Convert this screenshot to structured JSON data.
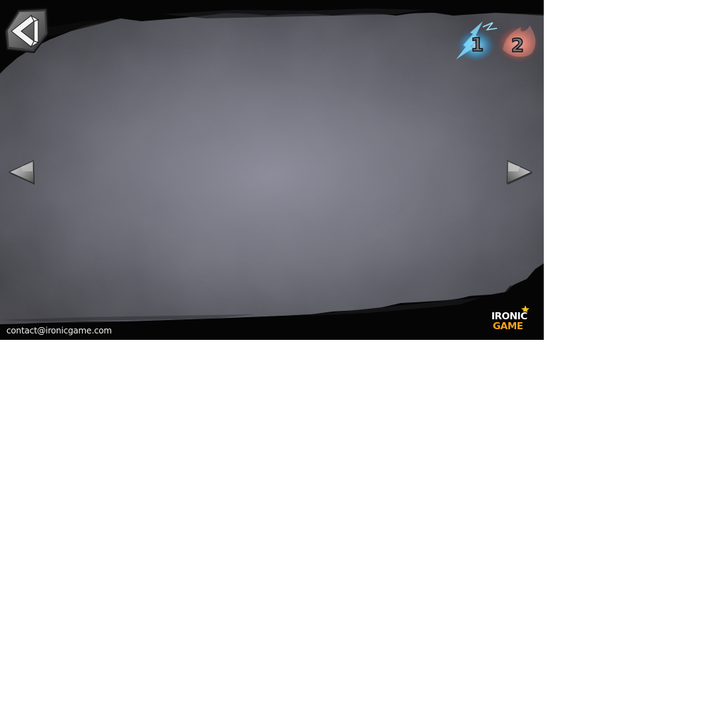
{
  "footer": {
    "contact_email": "contact@ironicgame.com"
  },
  "hud": {
    "player_badges": [
      {
        "label": "1",
        "glow_color": "#3fc0ff"
      },
      {
        "label": "2",
        "glow_color": "#ff7a6a"
      }
    ]
  },
  "logo": {
    "line_1": "IRONIC",
    "line_2": "GAME",
    "star_color": "#f6c21c",
    "accent_color": "#f6a21c"
  },
  "icons": {
    "home": "unity-cube-icon",
    "previous": "arrow-left-icon",
    "next": "arrow-right-icon"
  },
  "colors": {
    "panel_center": "#8a8a99",
    "panel_edge": "#3b3b41",
    "frame": "#050505",
    "text": "#f2f2f2"
  }
}
